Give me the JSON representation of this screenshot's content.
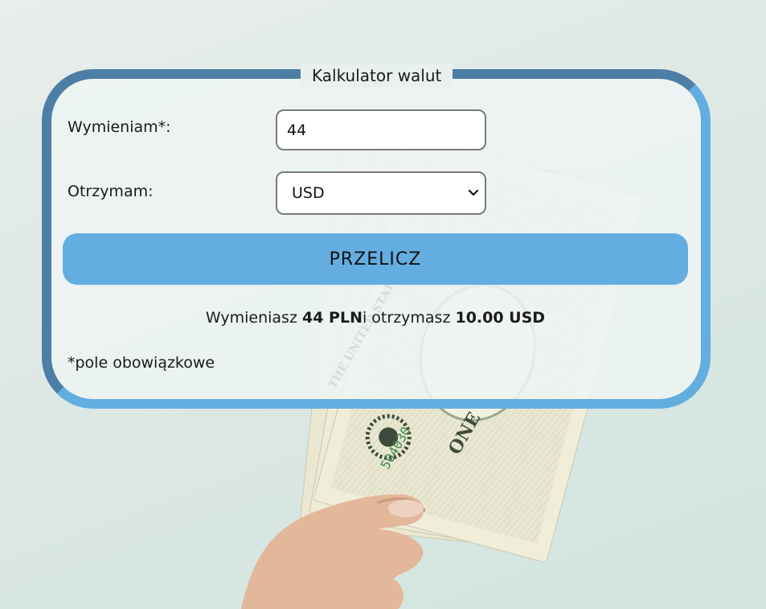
{
  "calculator": {
    "legend": "Kalkulator walut",
    "amount_label": "Wymieniam*:",
    "amount_value": "44",
    "currency_label": "Otrzymam:",
    "currency_selected": "USD",
    "submit_label": "PRZELICZ",
    "result": {
      "prefix": "Wymieniasz ",
      "amount": "44 PLN",
      "middle": "i otrzymasz ",
      "converted": "10.00 USD"
    },
    "required_note": "*pole obowiązkowe"
  },
  "background": {
    "image_subject": "hand holding fanned US dollar banknotes",
    "serial_fragment": "504030",
    "banknote_word_left": "THE UNITED STATES",
    "banknote_word_right": "ONE"
  },
  "colors": {
    "frame_dark": "#4d7ea5",
    "frame_light": "#62aee0",
    "button": "#64ade0"
  }
}
